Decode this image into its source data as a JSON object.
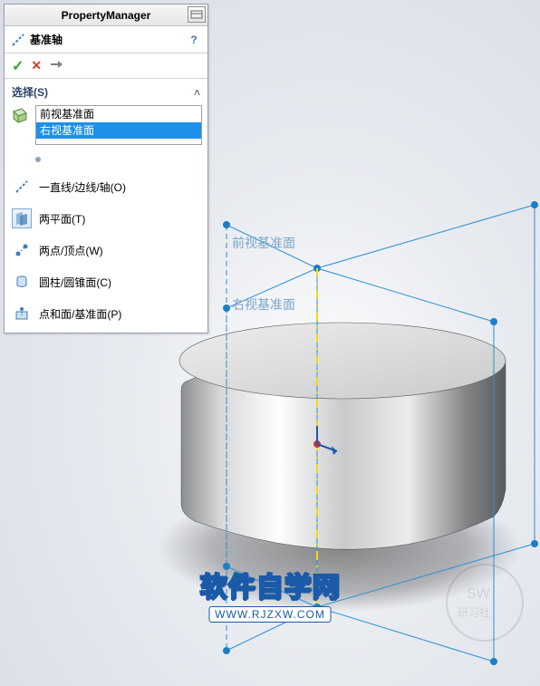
{
  "panel": {
    "title": "PropertyManager",
    "feature_name": "基准轴",
    "help": "?",
    "ok": "✓",
    "cancel": "✕",
    "pin": "⊸"
  },
  "section": {
    "header": "选择(S)",
    "list": [
      "前视基准面",
      "右视基准面"
    ],
    "selected_index": 1
  },
  "options": [
    {
      "label": "一直线/边线/轴(O)",
      "icon": "line-axis"
    },
    {
      "label": "两平面(T)",
      "icon": "two-planes"
    },
    {
      "label": "两点/顶点(W)",
      "icon": "two-points"
    },
    {
      "label": "圆柱/圆锥面(C)",
      "icon": "cylinder-cone"
    },
    {
      "label": "点和面/基准面(P)",
      "icon": "point-face"
    }
  ],
  "viewport": {
    "plane1_label": "前视基准面",
    "plane2_label": "右视基准面"
  },
  "watermark": {
    "big": "软件自学网",
    "small": "WWW.RJZXW.COM"
  }
}
